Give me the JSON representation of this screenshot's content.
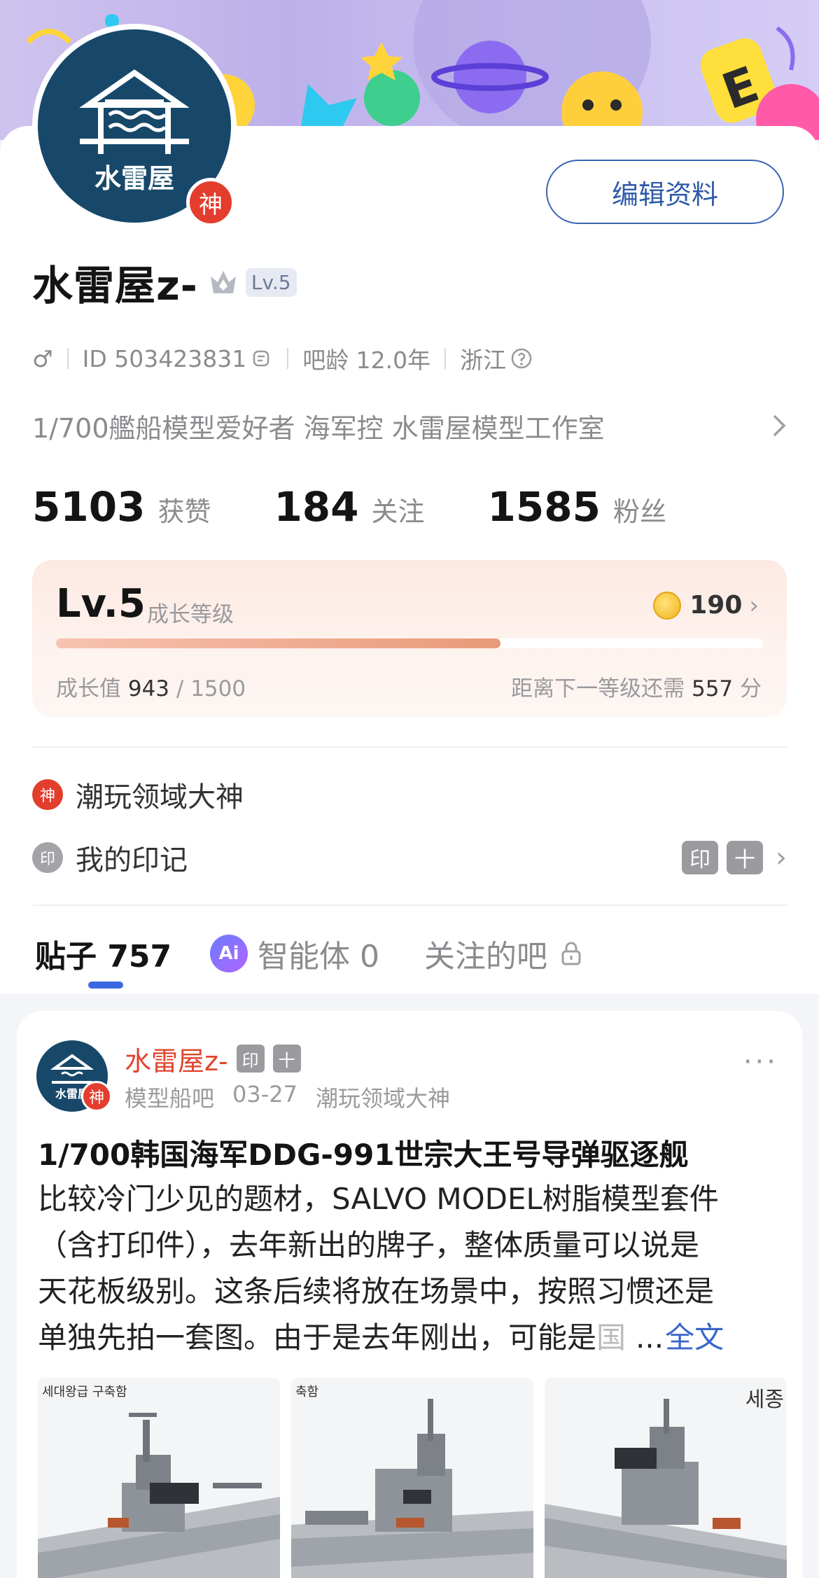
{
  "profile": {
    "username": "水雷屋z-",
    "god_badge": "神",
    "level_tag": "Lv.5",
    "edit_button": "编辑资料",
    "gender_symbol": "♂",
    "id_text": "ID 503423831",
    "bar_age": "吧龄 12.0年",
    "location": "浙江",
    "bio": "1/700艦船模型爱好者 海军控 水雷屋模型工作室",
    "avatar_text": "水雷屋"
  },
  "stats": [
    {
      "value": "5103",
      "label": "获赞"
    },
    {
      "value": "184",
      "label": "关注"
    },
    {
      "value": "1585",
      "label": "粉丝"
    }
  ],
  "level": {
    "title": "Lv.5",
    "subtitle": "成长等级",
    "coins": "190",
    "progress_label": "成长值",
    "progress_current": "943",
    "progress_total": "/ 1500",
    "progress_fraction": 0.629,
    "next_prefix": "距离下一等级还需",
    "next_value": "557",
    "next_suffix": "分"
  },
  "rows": {
    "domain_god_icon": "神",
    "domain_god_label": "潮玩领域大神",
    "marks_icon": "印",
    "marks_label": "我的印记",
    "stamp_1": "印",
    "stamp_2": "十"
  },
  "tabs": {
    "posts_label": "贴子 757",
    "agents_label": "智能体 0",
    "agents_icon": "Ai",
    "followed_bars_label": "关注的吧"
  },
  "post": {
    "author": "水雷屋z-",
    "stamp_1": "印",
    "stamp_2": "十",
    "bar_name": "模型船吧",
    "date": "03-27",
    "author_title": "潮玩领域大神",
    "title": "1/700韩国海军DDG-991世宗大王号导弹驱逐舰",
    "body_lines": [
      "比较冷门少见的题材，SALVO MODEL树脂模型套件",
      "（含打印件），去年新出的牌子，整体质量可以说是",
      "天花板级别。这条后续将放在场景中，按照习惯还是"
    ],
    "body_last_line": "单独先拍一套图。由于是去年刚出，可能是",
    "body_last_fade": "国",
    "ellipsis": "...",
    "full_text_link": "全文",
    "thumb_labels": [
      "세대왕급 구축함",
      "축함",
      "세종"
    ]
  }
}
